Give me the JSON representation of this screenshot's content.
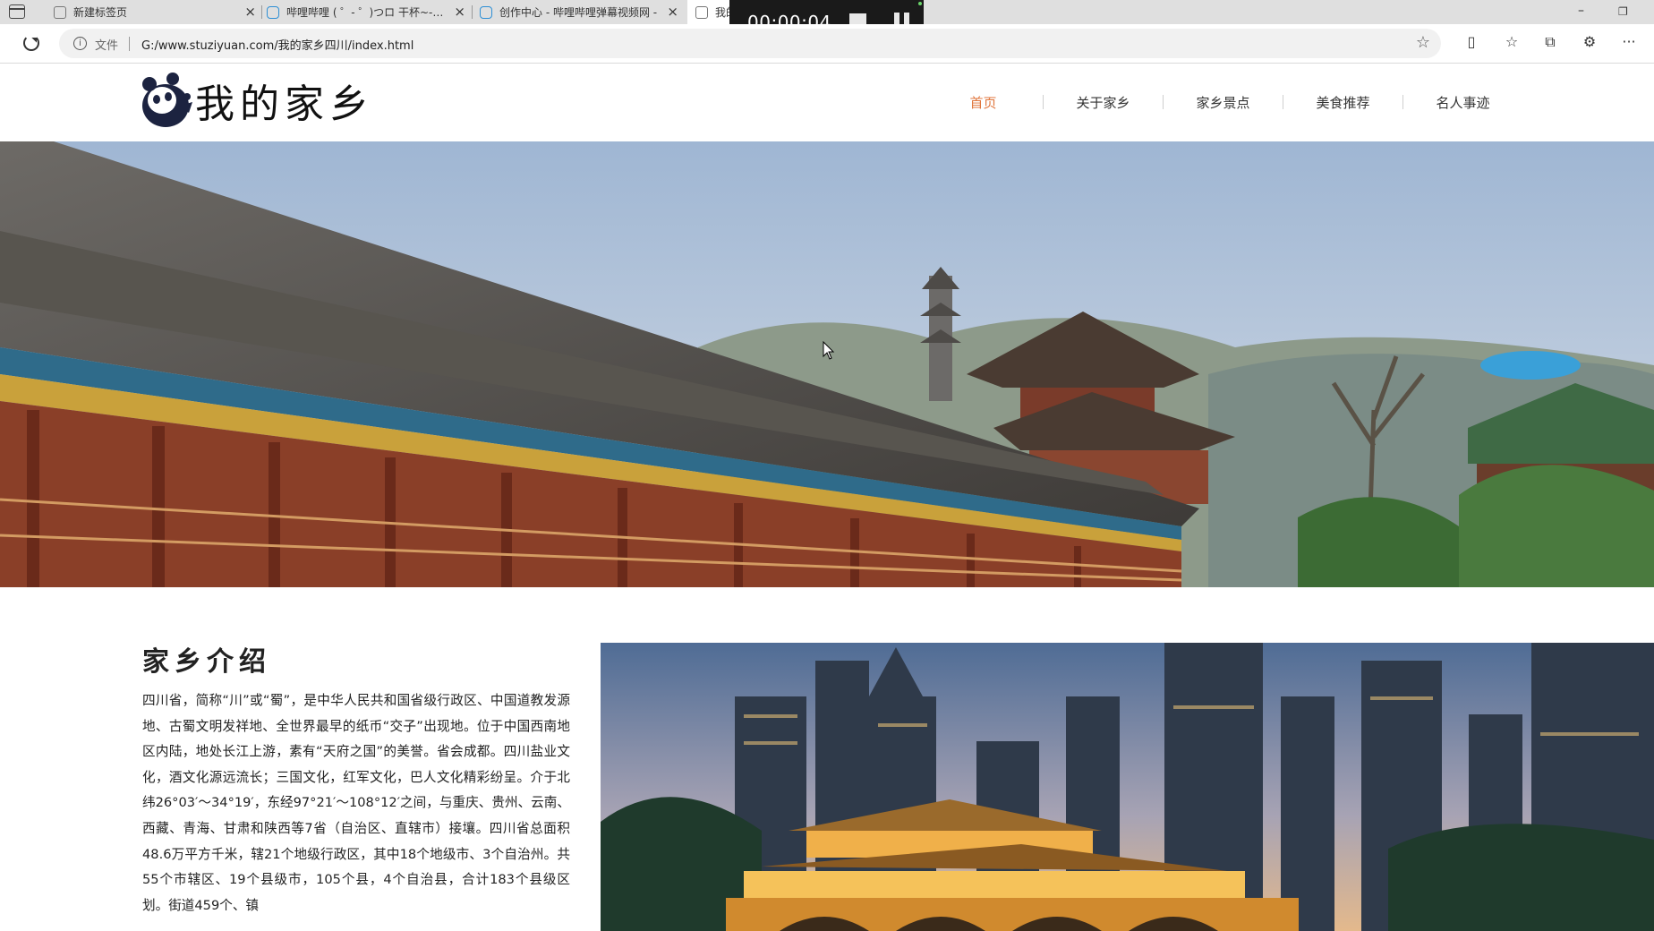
{
  "browser": {
    "tabs": [
      {
        "title": "新建标签页",
        "icon": "page-icon"
      },
      {
        "title": "哔哩哔哩 ( ゜- ゜)つロ 干杯~-bilibili",
        "icon": "bilibili-icon"
      },
      {
        "title": "创作中心 - 哔哩哔哩弹幕视频网 -",
        "icon": "bilibili-icon"
      },
      {
        "title": "我的家乡",
        "icon": "page-icon"
      }
    ],
    "address": {
      "scheme_label": "文件",
      "url": "G:/www.stuziyuan.com/我的家乡四川/index.html"
    },
    "recorder": {
      "elapsed": "00:00:04"
    }
  },
  "site": {
    "logo_text": "我的家乡",
    "nav": [
      {
        "label": "首页",
        "current": true
      },
      {
        "label": "关于家乡",
        "current": false
      },
      {
        "label": "家乡景点",
        "current": false
      },
      {
        "label": "美食推荐",
        "current": false
      },
      {
        "label": "名人事迹",
        "current": false
      }
    ],
    "accent_color": "#e0763c",
    "intro": {
      "heading": "家乡介绍",
      "body": "四川省，简称“川”或“蜀”，是中华人民共和国省级行政区、中国道教发源地、古蜀文明发祥地、全世界最早的纸币“交子”出现地。位于中国西南地区内陆，地处长江上游，素有“天府之国”的美誉。省会成都。四川盐业文化，酒文化源远流长；三国文化，红军文化，巴人文化精彩纷呈。介于北纬26°03′～34°19′，东经97°21′～108°12′之间，与重庆、贵州、云南、西藏、青海、甘肃和陕西等7省（自治区、直辖市）接壤。四川省总面积48.6万平方千米，辖21个地级行政区，其中18个地级市、3个自治州。共55个市辖区、19个县级市，105个县，4个自治县，合计183个县级区划。街道459个、镇"
    }
  }
}
